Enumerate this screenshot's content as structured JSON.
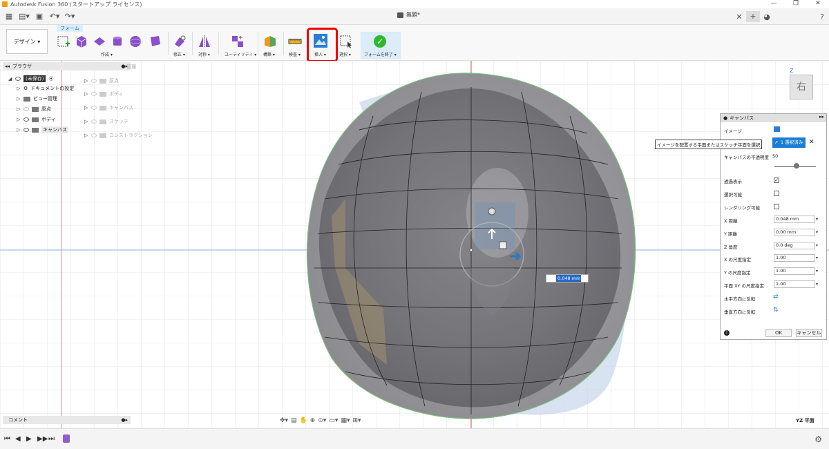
{
  "titlebar": {
    "app_title": "Autodesk Fusion 360 (スタートアップ ライセンス)"
  },
  "document": {
    "name": "無題*"
  },
  "ribbon": {
    "workspace": "デザイン ▾",
    "active_tab": "フォーム",
    "groups": [
      {
        "label": "作成 ▾"
      },
      {
        "label": "修正 ▾"
      },
      {
        "label": "対称 ▾"
      },
      {
        "label": "ユーティリティ ▾"
      },
      {
        "label": "構築 ▾"
      },
      {
        "label": "検査 ▾"
      },
      {
        "label": "挿入 ▾"
      },
      {
        "label": "選択 ▾"
      },
      {
        "label": "フォームを終了 ▾"
      }
    ]
  },
  "browser": {
    "title": "ブラウザ",
    "items": [
      {
        "label": "(未保存)"
      },
      {
        "label": "ドキュメントの設定"
      },
      {
        "label": "ビュー管理"
      },
      {
        "label": "原点"
      },
      {
        "label": "ボディ"
      },
      {
        "label": "キャンバス"
      }
    ],
    "ghost_items": [
      {
        "label": "原点"
      },
      {
        "label": "ボディ"
      },
      {
        "label": "キャンバス"
      },
      {
        "label": "スケッチ"
      },
      {
        "label": "コンストラクション"
      }
    ],
    "ghost_header": "管理"
  },
  "comment_bar": {
    "label": "コメント"
  },
  "viewcube": {
    "face": "右",
    "axis": "Z"
  },
  "view_plane": "YZ 平面",
  "dim_input": {
    "value": "0.048 mm"
  },
  "canvas_panel": {
    "title": "キャンバス",
    "tooltip": "イメージを配置する平面またはスケッチ平面を選択",
    "image_label": "イメージ",
    "select_button": "1 選択済み",
    "opacity_label": "キャンバスの不透明度",
    "opacity_value": "50",
    "opacity_percent": 50,
    "display_through_label": "透過表示",
    "display_through_checked": true,
    "selectable_label": "選択可能",
    "selectable_checked": false,
    "render_label": "レンダリング可能",
    "render_checked": false,
    "x_dist_label": "X 距離",
    "x_dist_value": "0.048 mm",
    "y_dist_label": "Y 距離",
    "y_dist_value": "0.00 mm",
    "z_angle_label": "Z 角度",
    "z_angle_value": "0.0 deg",
    "x_scale_label": "X の尺度指定",
    "x_scale_value": "1.00",
    "y_scale_label": "Y の尺度指定",
    "y_scale_value": "1.00",
    "xy_scale_label": "平面 XY の尺度指定",
    "xy_scale_value": "1.00",
    "flip_h_label": "水平方向に反転",
    "flip_v_label": "垂直方向に反転",
    "ok": "OK",
    "cancel": "キャンセル"
  }
}
